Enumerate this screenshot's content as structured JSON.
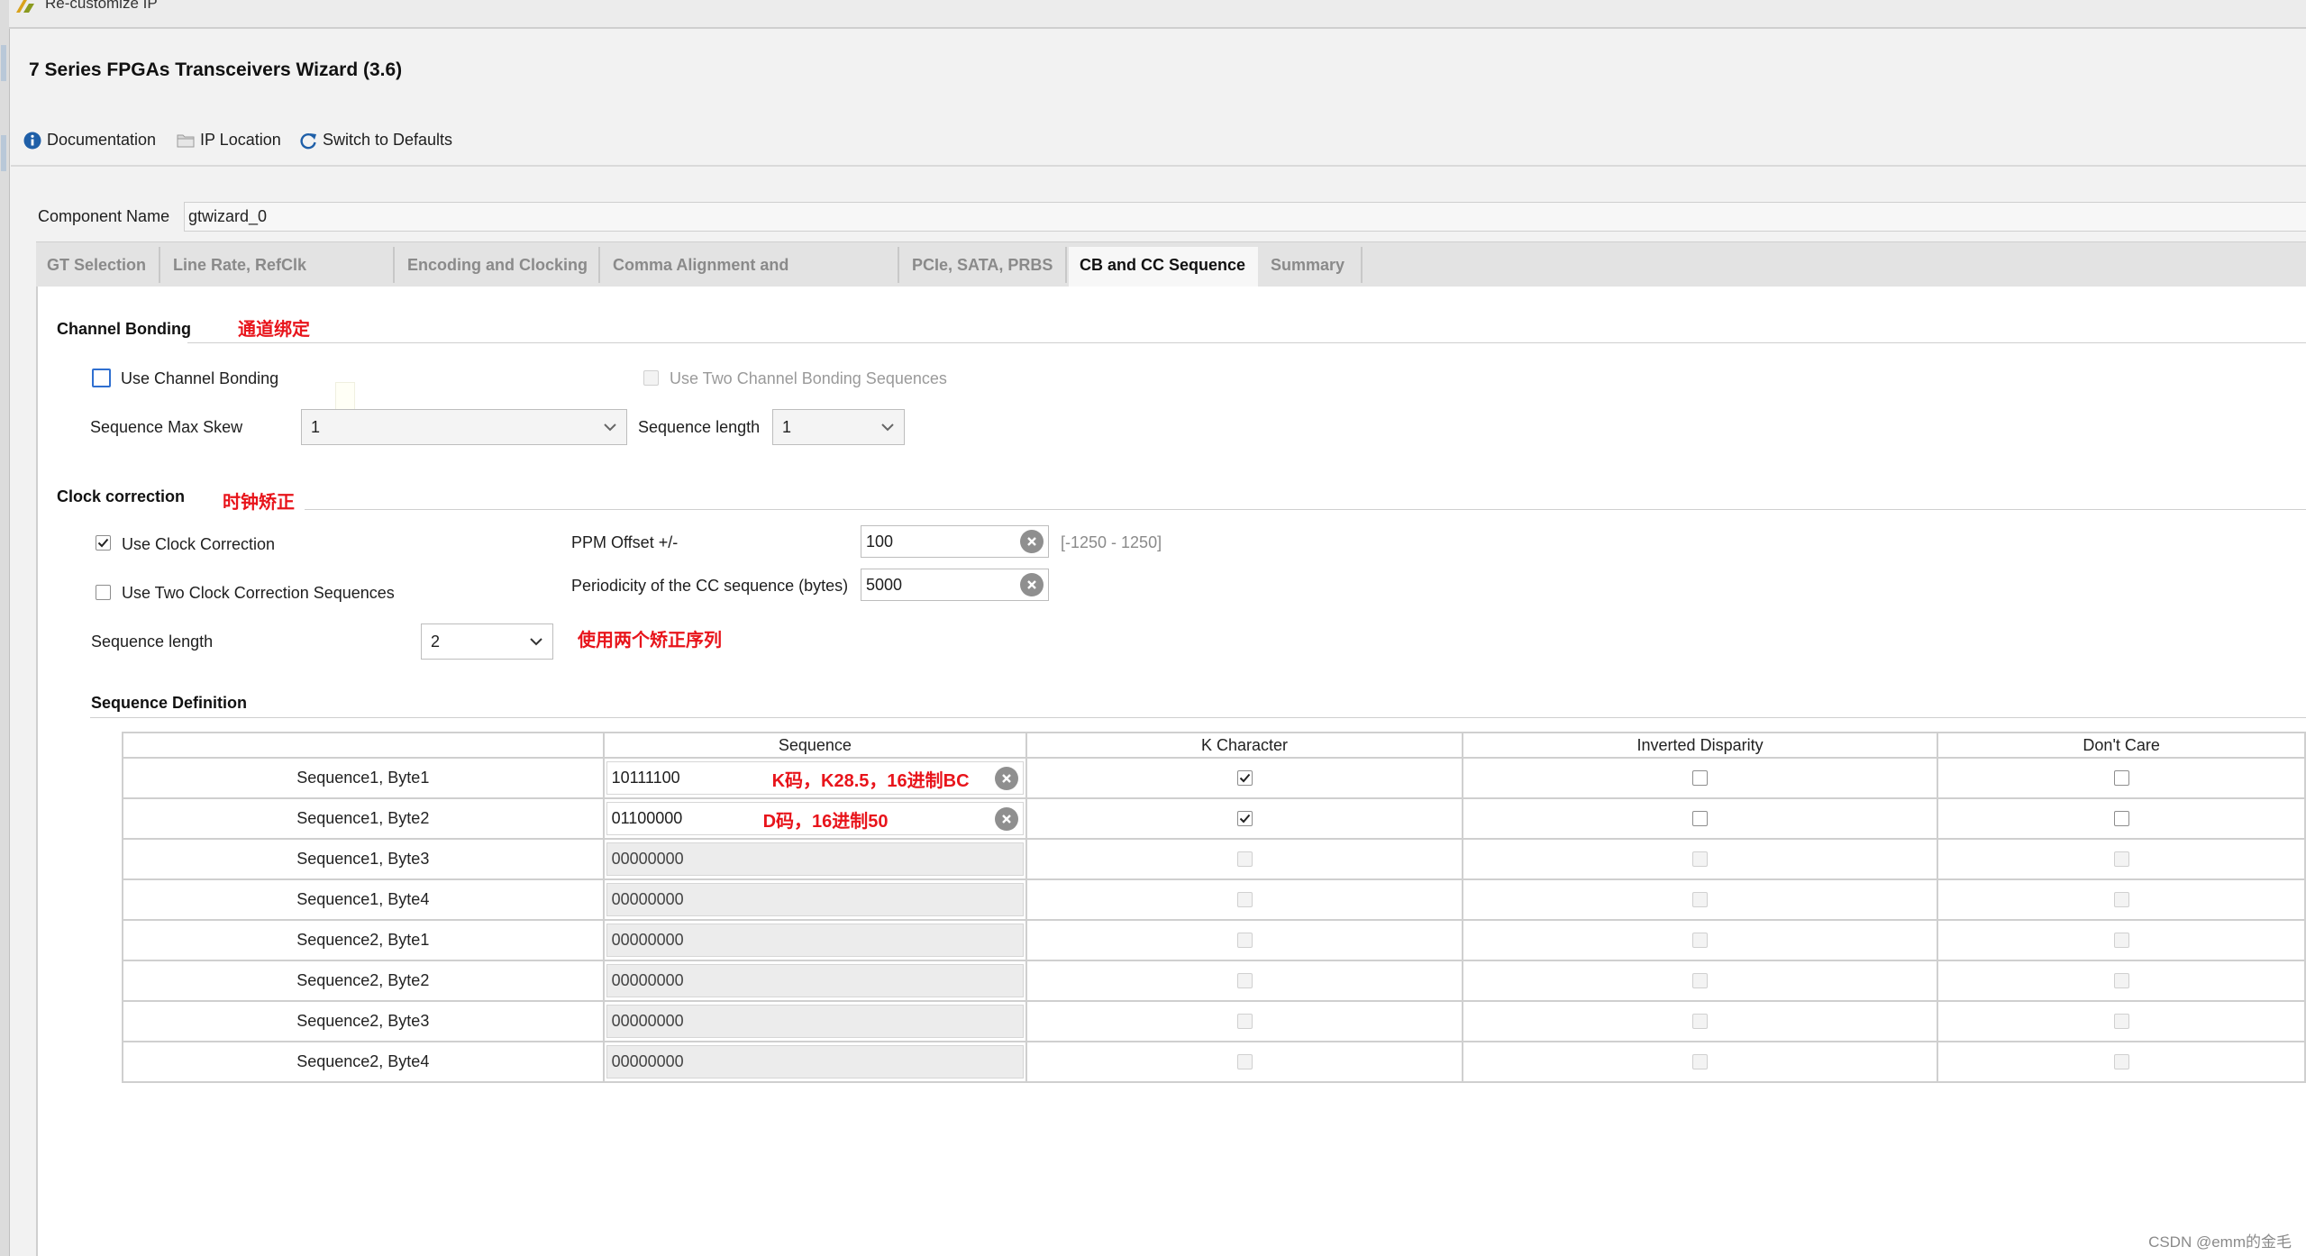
{
  "window": {
    "title": "Re-customize IP"
  },
  "wizard": {
    "title": "7 Series FPGAs Transceivers Wizard (3.6)"
  },
  "toolbar": {
    "documentation": "Documentation",
    "ip_location": "IP Location",
    "switch_to_defaults": "Switch to Defaults"
  },
  "component": {
    "label": "Component Name",
    "value": "gtwizard_0"
  },
  "tabs": [
    {
      "label": "GT Selection",
      "active": false
    },
    {
      "label": "Line Rate, RefClk Selection",
      "active": false
    },
    {
      "label": "Encoding and Clocking",
      "active": false
    },
    {
      "label": "Comma Alignment and Equalization",
      "active": false
    },
    {
      "label": "PCIe, SATA, PRBS",
      "active": false
    },
    {
      "label": "CB and CC Sequence",
      "active": true
    },
    {
      "label": "Summary",
      "active": false
    }
  ],
  "channel_bonding": {
    "title": "Channel Bonding",
    "annotation": "通道绑定",
    "use_channel_bonding": {
      "label": "Use Channel Bonding",
      "checked": false
    },
    "use_two_sequences": {
      "label": "Use Two Channel Bonding Sequences",
      "checked": false,
      "enabled": false
    },
    "max_skew": {
      "label": "Sequence Max Skew",
      "value": "1"
    },
    "seq_length": {
      "label": "Sequence length",
      "value": "1"
    }
  },
  "clock_correction": {
    "title": "Clock correction",
    "annotation": "时钟矫正",
    "use_clock_correction": {
      "label": "Use Clock Correction",
      "checked": true
    },
    "use_two_sequences": {
      "label": "Use Two Clock Correction Sequences",
      "checked": false
    },
    "seq_length": {
      "label": "Sequence length",
      "value": "2"
    },
    "seq_length_annotation": "使用两个矫正序列",
    "ppm_offset": {
      "label": "PPM Offset +/-",
      "value": "100",
      "range": "[-1250 - 1250]"
    },
    "periodicity": {
      "label": "Periodicity of the CC sequence (bytes)",
      "value": "5000"
    }
  },
  "sequence_definition": {
    "title": "Sequence Definition",
    "columns": [
      "",
      "Sequence",
      "K Character",
      "Inverted Disparity",
      "Don't Care"
    ],
    "rows": [
      {
        "name": "Sequence1, Byte1",
        "value": "10111100",
        "k": true,
        "inv": false,
        "dc": false,
        "enabled": true,
        "annotation": "K码，K28.5，16进制BC"
      },
      {
        "name": "Sequence1, Byte2",
        "value": "01100000",
        "k": true,
        "inv": false,
        "dc": false,
        "enabled": true,
        "annotation": "D码，16进制50"
      },
      {
        "name": "Sequence1, Byte3",
        "value": "00000000",
        "k": false,
        "inv": false,
        "dc": false,
        "enabled": false,
        "annotation": ""
      },
      {
        "name": "Sequence1, Byte4",
        "value": "00000000",
        "k": false,
        "inv": false,
        "dc": false,
        "enabled": false,
        "annotation": ""
      },
      {
        "name": "Sequence2, Byte1",
        "value": "00000000",
        "k": false,
        "inv": false,
        "dc": false,
        "enabled": false,
        "annotation": ""
      },
      {
        "name": "Sequence2, Byte2",
        "value": "00000000",
        "k": false,
        "inv": false,
        "dc": false,
        "enabled": false,
        "annotation": ""
      },
      {
        "name": "Sequence2, Byte3",
        "value": "00000000",
        "k": false,
        "inv": false,
        "dc": false,
        "enabled": false,
        "annotation": ""
      },
      {
        "name": "Sequence2, Byte4",
        "value": "00000000",
        "k": false,
        "inv": false,
        "dc": false,
        "enabled": false,
        "annotation": ""
      }
    ]
  },
  "watermark": "CSDN @emm的金毛",
  "colors": {
    "annotation_red": "#e8141b",
    "focus_blue": "#2f6fd0",
    "info_blue": "#1f5fa8"
  }
}
